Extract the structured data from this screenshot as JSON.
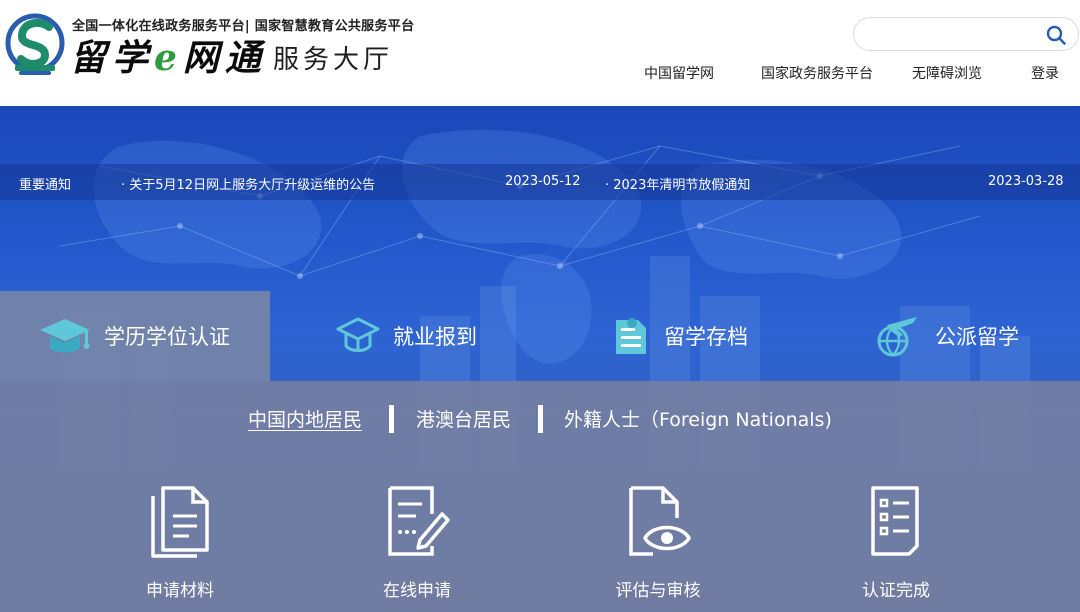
{
  "header": {
    "subtitle": "全国一体化在线政务服务平台| 国家智慧教育公共服务平台",
    "brand_main": "留学",
    "brand_e": "e",
    "brand_main2": "网通",
    "brand_tail": "服务大厅",
    "search_placeholder": "",
    "nav": [
      "中国留学网",
      "国家政务服务平台",
      "无障碍浏览",
      "登录"
    ]
  },
  "notice": {
    "label": "重要通知",
    "items": [
      {
        "title": "· 关于5月12日网上服务大厅升级运维的公告",
        "date": "2023-05-12"
      },
      {
        "title": "· 2023年清明节放假通知",
        "date": "2023-03-28"
      }
    ]
  },
  "tabs": [
    {
      "label": "学历学位认证",
      "icon": "graduation-cap-icon",
      "active": true
    },
    {
      "label": "就业报到",
      "icon": "graduation-cap-outline-icon",
      "active": false
    },
    {
      "label": "留学存档",
      "icon": "archive-document-icon",
      "active": false
    },
    {
      "label": "公派留学",
      "icon": "airplane-globe-icon",
      "active": false
    }
  ],
  "subtabs": [
    {
      "label": "中国内地居民",
      "active": true
    },
    {
      "label": "港澳台居民",
      "active": false
    },
    {
      "label": "外籍人士（Foreign Nationals)",
      "active": false
    }
  ],
  "steps": [
    {
      "label": "申请材料",
      "icon": "documents-icon"
    },
    {
      "label": "在线申请",
      "icon": "edit-form-icon"
    },
    {
      "label": "评估与审核",
      "icon": "document-eye-icon"
    },
    {
      "label": "认证完成",
      "icon": "checklist-icon"
    }
  ],
  "colors": {
    "brand_green": "#2f9b3d",
    "banner_blue": "#2359cc",
    "logo_teal": "#1e8c6a",
    "logo_blue": "#2a5db0"
  }
}
